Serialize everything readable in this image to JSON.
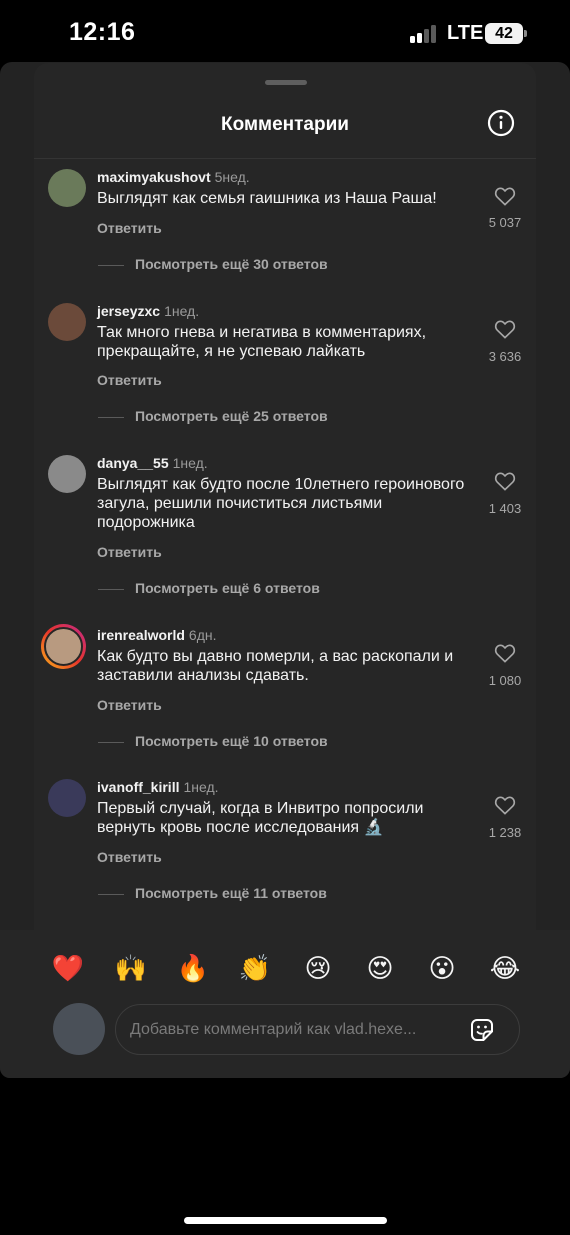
{
  "status_bar": {
    "time": "12:16",
    "network": "LTE",
    "battery": "42"
  },
  "header": {
    "title": "Комментарии",
    "info_icon": "info-circle-icon"
  },
  "comments": [
    {
      "username": "maximyakushovt",
      "age": "5нед.",
      "text": "Выглядят как семья гаишника из Наша Раша!",
      "reply": "Ответить",
      "likes": "5 037",
      "more_replies": "Посмотреть ещё 30 ответов",
      "avatar_color": "#6a7a5a"
    },
    {
      "username": "jerseyzxc",
      "age": "1нед.",
      "text": "Так много гнева и негатива в комментариях, прекращайте, я не успеваю лайкать",
      "reply": "Ответить",
      "likes": "3 636",
      "more_replies": "Посмотреть ещё 25 ответов",
      "avatar_color": "#6b4a3a"
    },
    {
      "username": "danya__55",
      "age": "1нед.",
      "text": "Выглядят как будто после 10летнего героинового загула, решили почиститься листьями подорожника",
      "reply": "Ответить",
      "likes": "1 403",
      "more_replies": "Посмотреть ещё 6 ответов",
      "avatar_color": "#8a8a8a"
    },
    {
      "username": "irenrealworld",
      "age": "6дн.",
      "text": "Как будто вы давно померли, а вас раскопали и заставили анализы сдавать.",
      "reply": "Ответить",
      "likes": "1 080",
      "more_replies": "Посмотреть ещё 10 ответов",
      "avatar_color": "#b89a80"
    },
    {
      "username": "ivanoff_kirill",
      "age": "1нед.",
      "text": "Первый случай, когда в Инвитро попросили вернуть кровь после исследования 🔬",
      "reply": "Ответить",
      "likes": "1 238",
      "more_replies": "Посмотреть ещё 11 ответов",
      "avatar_color": "#3a3a5a"
    }
  ],
  "reactions": [
    "❤️",
    "🙌",
    "🔥",
    "👏",
    "😢",
    "😍",
    "😮",
    "😂"
  ],
  "composer": {
    "placeholder": "Добавьте комментарий как vlad.hexe...",
    "sticker_icon": "sticker-icon"
  },
  "colors": {
    "background": "#000000",
    "sheet": "#262626",
    "text": "#f2f2f2",
    "muted": "#a8a8a8"
  }
}
